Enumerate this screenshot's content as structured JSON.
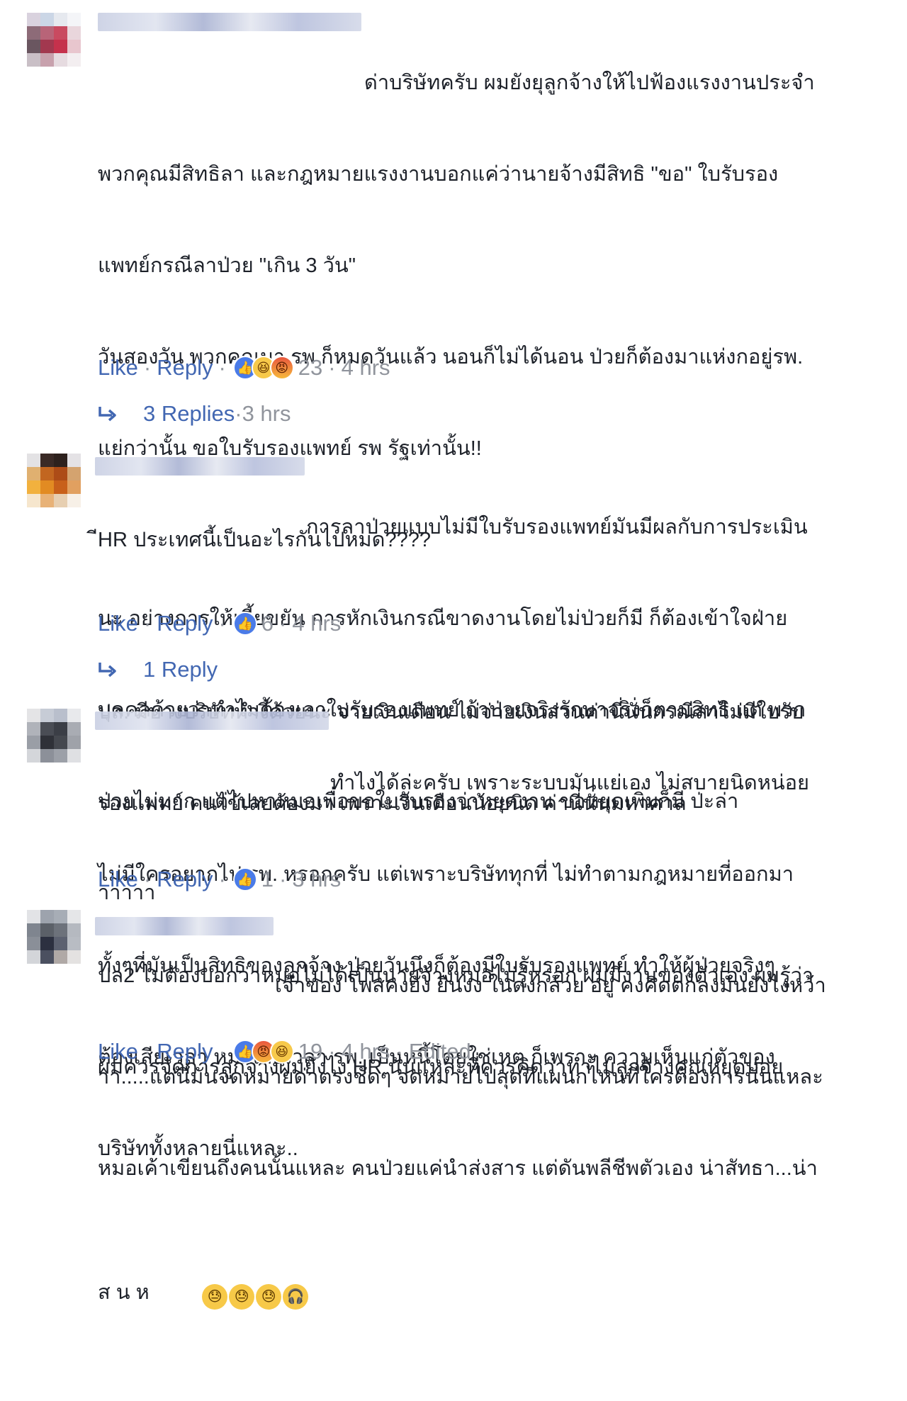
{
  "actions": {
    "like": "Like",
    "reply": "Reply",
    "dot": "·"
  },
  "comments": [
    {
      "lines": [
        "ด่าบริษัทครับ ผมยังยุลูกจ้างให้ไปฟ้องแรงงานประจำ",
        "พวกคุณมีสิทธิลา และกฎหมายแรงงานบอกแค่ว่านายจ้างมีสิทธิ \"ขอ\" ใบรับรอง",
        "แพทย์กรณีลาป่วย \"เกิน 3 วัน\"",
        "วันสองวัน พวกคุณมา รพ ก็หมดวันแล้ว นอนก็ไม่ได้นอน ป่วยก็ต้องมาแห่งกอยู่รพ.",
        "แย่กว่านั้น ขอใบรับรองแพทย์ รพ รัฐเท่านั้น!!",
        "ีHR ประเทศนี้เป็นอะไรกันไปหมด????",
        "",
        "ปล. มีบางบริษัททำงี้ด้วยนะ จ่ายเงินเดือน ไม่จ่ายเงินส่วนค่านี่นั่นกรณีลาไม่มีใบรับ",
        "รองแพทย์ คนไข้เลยต้องมา เพราะเงินเดือนน้อยนิด ค่านี่นั่นมหาศาล",
        "",
        "ปล2 ไม่ต้องบอกว่าหมอไม่ได้เป็นนายจ้างหมอไม่รู้หรอก ผมมีงานของตัวเอง ผมรู้ว่า",
        "ผมควรจัดการลูกจ้างผมยังไง HR นั่นแหละที่ควรคิดว่าทำไมลูกจ้างคุณหยุดบ่อย"
      ],
      "reaction_count": "23",
      "time": "4 hrs",
      "reply_link": "3 Replies",
      "reply_time": "3 hrs"
    },
    {
      "lines": [
        "การลาป่วยแบบไม่มีใบรับรองแพทย์มันมีผลกับการประเมิน",
        "นะ อย่างการให้เบี้ยขยัน การหักเงินกรณีขาดงานโดยไม่ป่วยก็มี ก็ต้องเข้าใจฝ่าย",
        "บุคคลด้วยว่าทำไมต้องเอาใบรับรองแพทย์ ถ้าป่วยจริงรักษาจริงก็ตามสิทธิ แต่ พวก",
        "ป่วยไม่มาก แต่ไปหาหมอเพื่อขอใบรับรองว่าหยุดงาน ขอหยุดเพิ่มก็มี ป่ะล่า",
        "าาาาา"
      ],
      "reaction_count": "6",
      "time": "4 hrs",
      "reply_link": "1 Reply"
    },
    {
      "lines": [
        "ทำไงได้ล่ะครับ เพราะระบบมันแย่เอง ไม่สบายนิดหน่อย",
        "ไม่มีใครอยากไป รพ. หรอกครับ แต่เพราะบริษัททุกที่ ไม่ทำตามกฎหมายที่ออกมา",
        "ทั้งๆที่มันเป็นสิทธิของลูกจ้าง ป่วยวันนึงก็ต้องมีใบรับรองแพทย์ ทำให้ผู้ป่วยจริงๆ",
        "ต้องเสียเวลา หมอเสียเวลา รพ. เป็นหนี้โดยใช่เหตุ ก็เพราะ ความเห็นแก่ตัวของ",
        "บริษัททั้งหลายนี่แหละ.."
      ],
      "reaction_count": "1",
      "time": "3 hrs"
    },
    {
      "lines": [
        "เจ้าของ โพสคงยัง ยืนงง ในดงกล้วย อยู่ คงคิดตกลงมันยังไงหว้า",
        "าา.....แต่นี่มันจดหมายด่าตรงชัดๆ จดหมายไปสุดที่แผนกไหนที่ใครต้องการนั่นแหละ",
        "หมอเค้าเขียนถึงคนนั้นแหละ คนป่วยแค่นำส่งสาร แต่ดันพลีชีพตัวเอง น่าสัทธา...น่า",
        "ส น ห"
      ],
      "reaction_count": "19",
      "time": "4 hrs",
      "edited": "Edited"
    }
  ],
  "icons": {
    "like_reaction": "thumbs-up",
    "haha_reaction": "laughing-face",
    "angry_reaction": "angry-face",
    "reply_arrow": "reply-arrow",
    "sad_sweat_emoji": "downcast-sweat-face",
    "headphones_emoji": "headphones"
  },
  "colors": {
    "link": "#4267b2",
    "meta": "#90949c",
    "text": "#1d2129",
    "like": "#4a7be8"
  }
}
